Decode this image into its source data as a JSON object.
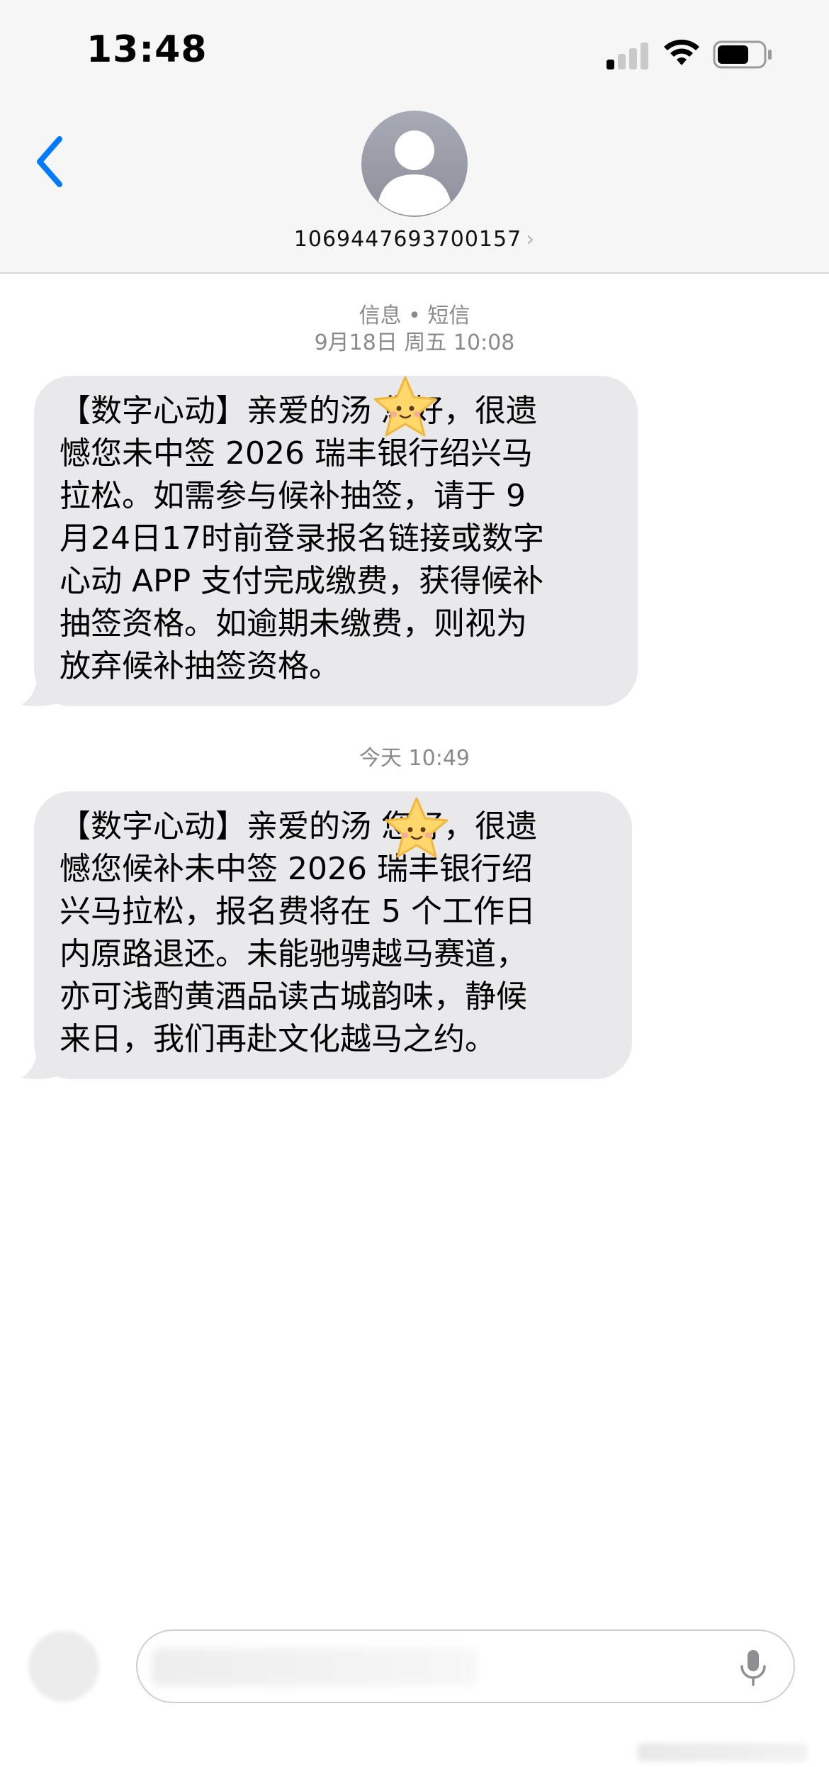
{
  "status_bar": {
    "time": "13:48",
    "signal_bars": 4,
    "signal_active_bars": 1,
    "battery_level": 0.7
  },
  "header": {
    "back_icon": "chevron-left-icon",
    "avatar_icon": "person-silhouette-icon",
    "contact_number": "1069447693700157",
    "chevron": "›"
  },
  "conversation": {
    "service_label": "信息 • 短信",
    "first_timestamp": "9月18日 周五 10:08",
    "second_timestamp": "今天 10:49",
    "messages": [
      {
        "lines": [
          "【数字心动】亲爱的汤 您好，很遗",
          "憾您未中签 2026 瑞丰银行绍兴马",
          "拉松。如需参与候补抽签，请于 9",
          "月24日17时前登录报名链接或数字",
          "心动 APP 支付完成缴费，获得候补",
          "抽签资格。如逾期未缴费，则视为",
          "放弃候补抽签资格。"
        ]
      },
      {
        "lines": [
          "【数字心动】亲爱的汤 您好，很遗",
          "憾您候补未中签 2026 瑞丰银行绍",
          "兴马拉松，报名费将在 5 个工作日",
          "内原路退还。未能驰骋越马赛道，",
          "亦可浅酌黄酒品读古城韵味，静候",
          "来日，我们再赴文化越马之约。"
        ]
      }
    ]
  },
  "composer": {
    "apps_icon": "plus-icon",
    "mic_icon": "microphone-icon"
  },
  "colors": {
    "accent": "#007aff",
    "bubble_gray": "#e9e9eb",
    "timestamp_gray": "#8a8a8e",
    "header_bg": "#f6f6f6"
  }
}
